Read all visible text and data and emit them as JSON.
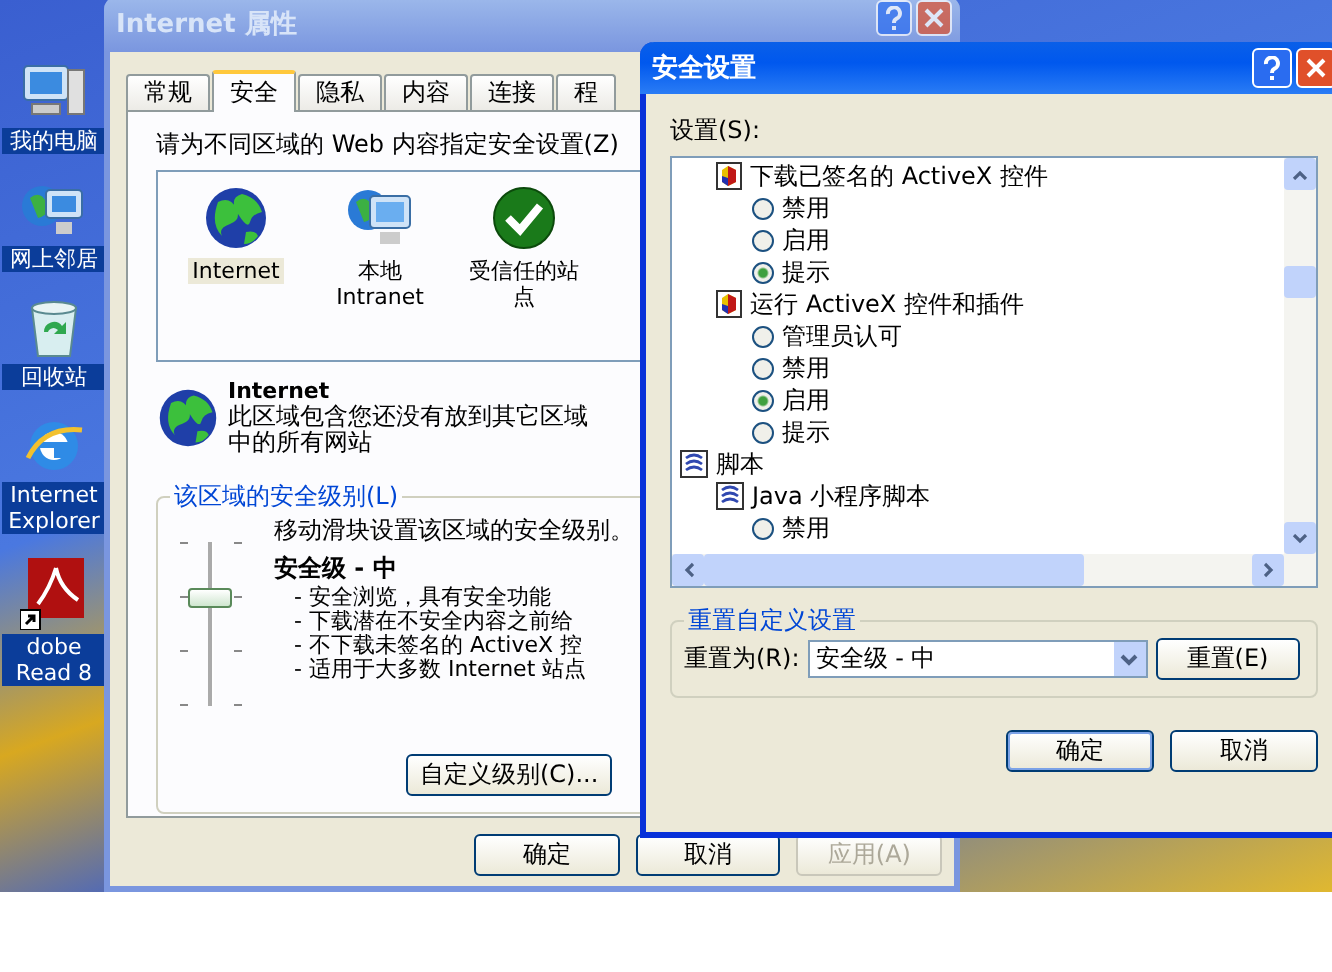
{
  "desktop": {
    "icons": [
      {
        "label": "我的电脑",
        "kind": "computer"
      },
      {
        "label": "网上邻居",
        "kind": "network"
      },
      {
        "label": "回收站",
        "kind": "recycle"
      },
      {
        "label": "Internet Explorer",
        "kind": "browser"
      },
      {
        "label": "dobe Read 8",
        "kind": "pdf"
      }
    ]
  },
  "properties_window": {
    "title": "Internet 属性",
    "tabs": [
      {
        "label": "常规",
        "selected": false
      },
      {
        "label": "安全",
        "selected": true
      },
      {
        "label": "隐私",
        "selected": false
      },
      {
        "label": "内容",
        "selected": false
      },
      {
        "label": "连接",
        "selected": false
      },
      {
        "label": "程",
        "selected": false
      }
    ],
    "zones_prompt": "请为不同区域的 Web 内容指定安全设置(Z)",
    "zones": [
      {
        "label": "Internet",
        "kind": "globe",
        "selected": true
      },
      {
        "label": "本地 Intranet",
        "kind": "monitor",
        "selected": false
      },
      {
        "label": "受信任的站点",
        "kind": "check",
        "selected": false
      }
    ],
    "zone_info": {
      "title": "Internet",
      "description": "此区域包含您还没有放到其它区域中的所有网站"
    },
    "level_group": {
      "title": "该区域的安全级别(L)",
      "hint": "移动滑块设置该区域的安全级别。",
      "level_name": "安全级 - 中",
      "slider": {
        "level": 0.67
      },
      "bullets": [
        "- 安全浏览，具有安全功能",
        "- 下载潜在不安全内容之前给",
        "- 不下载未签名的 ActiveX 控",
        "- 适用于大多数 Internet 站点"
      ],
      "custom_button": "自定义级别(C)..."
    },
    "buttons": [
      {
        "label": "确定",
        "disabled": false
      },
      {
        "label": "取消",
        "disabled": false
      },
      {
        "label": "应用(A)",
        "disabled": true
      }
    ]
  },
  "security_dialog": {
    "title": "安全设置",
    "settings_label": "设置(S):",
    "tree": [
      {
        "label": "下载已签名的 ActiveX 控件",
        "kind": "setting",
        "children": [
          {
            "label": "禁用",
            "kind": "radio",
            "selected": false
          },
          {
            "label": "启用",
            "kind": "radio",
            "selected": false
          },
          {
            "label": "提示",
            "kind": "radio",
            "selected": true
          }
        ]
      },
      {
        "label": "运行 ActiveX 控件和插件",
        "kind": "setting",
        "children": [
          {
            "label": "管理员认可",
            "kind": "radio",
            "selected": false
          },
          {
            "label": "禁用",
            "kind": "radio",
            "selected": false
          },
          {
            "label": "启用",
            "kind": "radio",
            "selected": true
          },
          {
            "label": "提示",
            "kind": "radio",
            "selected": false
          }
        ]
      },
      {
        "label": "脚本",
        "kind": "category",
        "children": [
          {
            "label": "Java 小程序脚本",
            "kind": "category",
            "children": [
              {
                "label": "禁用",
                "kind": "radio",
                "selected": false
              }
            ]
          }
        ]
      }
    ],
    "reset_group": {
      "title": "重置自定义设置",
      "label": "重置为(R):",
      "value": "安全级 - 中",
      "button": "重置(E)"
    },
    "buttons": [
      "确定",
      "取消"
    ]
  }
}
